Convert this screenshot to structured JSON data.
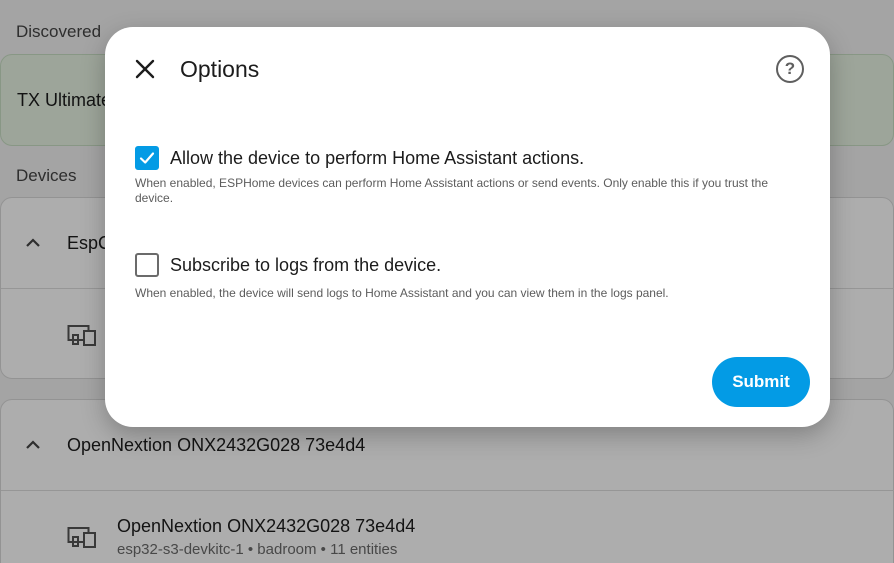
{
  "background": {
    "discovered_header": "Discovered",
    "discovered_item": "TX Ultimate",
    "devices_header": "Devices",
    "group1_title": "EspC",
    "group2_title": "OpenNextion ONX2432G028 73e4d4",
    "device2_name": "OpenNextion ONX2432G028 73e4d4",
    "device2_sub": "esp32-s3-devkitc-1 • badroom • 11 entities"
  },
  "dialog": {
    "title": "Options",
    "options": [
      {
        "label": "Allow the device to perform Home Assistant actions.",
        "help": "When enabled, ESPHome devices can perform Home Assistant actions or send events. Only enable this if you trust the device.",
        "checked": true
      },
      {
        "label": "Subscribe to logs from the device.",
        "help": "When enabled, the device will send logs to Home Assistant and you can view them in the logs panel.",
        "checked": false
      }
    ],
    "submit_label": "Submit",
    "help_glyph": "?"
  },
  "colors": {
    "accent": "#039be5",
    "discovered_bg": "#e7f4e4"
  },
  "icons": [
    "close-icon",
    "help-icon",
    "check-icon",
    "chevron-up-icon",
    "devices-icon"
  ]
}
